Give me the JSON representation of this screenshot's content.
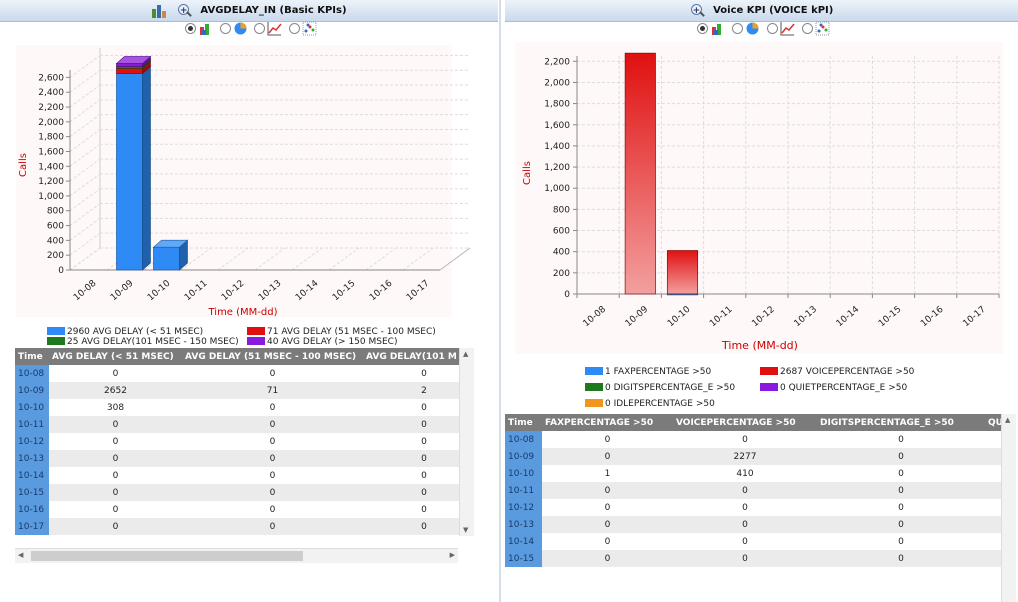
{
  "left": {
    "title": "AVGDELAY_IN (Basic KPIs)",
    "xlabel": "Time (MM-dd)",
    "ylabel": "Calls",
    "legend": [
      {
        "label": "2960 AVG DELAY (< 51 MSEC)",
        "color": "#2e8bf5"
      },
      {
        "label": "71 AVG DELAY (51 MSEC - 100 MSEC)",
        "color": "#e01010"
      },
      {
        "label": "25 AVG DELAY(101 MSEC - 150 MSEC)",
        "color": "#1f7a1f"
      },
      {
        "label": "40 AVG DELAY (> 150 MSEC)",
        "color": "#8a1adb"
      }
    ],
    "table": {
      "headers": [
        "Time",
        "AVG DELAY (< 51 MSEC)",
        "AVG DELAY (51 MSEC - 100 MSEC)",
        "AVG DELAY(101 M"
      ],
      "rows": [
        [
          "10-08",
          "0",
          "0",
          "0"
        ],
        [
          "10-09",
          "2652",
          "71",
          "2"
        ],
        [
          "10-10",
          "308",
          "0",
          "0"
        ],
        [
          "10-11",
          "0",
          "0",
          "0"
        ],
        [
          "10-12",
          "0",
          "0",
          "0"
        ],
        [
          "10-13",
          "0",
          "0",
          "0"
        ],
        [
          "10-14",
          "0",
          "0",
          "0"
        ],
        [
          "10-15",
          "0",
          "0",
          "0"
        ],
        [
          "10-16",
          "0",
          "0",
          "0"
        ],
        [
          "10-17",
          "0",
          "0",
          "0"
        ]
      ]
    }
  },
  "right": {
    "title": "Voice KPI (VOICE kPI)",
    "xlabel": "Time (MM-dd)",
    "ylabel": "Calls",
    "legend": [
      {
        "label": "1 FAXPERCENTAGE >50",
        "color": "#2e8bf5"
      },
      {
        "label": "2687 VOICEPERCENTAGE >50",
        "color": "#e01010"
      },
      {
        "label": "0 DIGITSPERCENTAGE_E >50",
        "color": "#1f7a1f"
      },
      {
        "label": "0 QUIETPERCENTAGE_E >50",
        "color": "#8a1adb"
      },
      {
        "label": "0 IDLEPERCENTAGE >50",
        "color": "#f0961e"
      }
    ],
    "table": {
      "headers": [
        "Time",
        "FAXPERCENTAGE >50",
        "VOICEPERCENTAGE >50",
        "DIGITSPERCENTAGE_E >50",
        "QU"
      ],
      "rows": [
        [
          "10-08",
          "0",
          "0",
          "0"
        ],
        [
          "10-09",
          "0",
          "2277",
          "0"
        ],
        [
          "10-10",
          "1",
          "410",
          "0"
        ],
        [
          "10-11",
          "0",
          "0",
          "0"
        ],
        [
          "10-12",
          "0",
          "0",
          "0"
        ],
        [
          "10-13",
          "0",
          "0",
          "0"
        ],
        [
          "10-14",
          "0",
          "0",
          "0"
        ],
        [
          "10-15",
          "0",
          "0",
          "0"
        ]
      ]
    }
  },
  "chart_data": [
    {
      "type": "bar",
      "stacked": true,
      "three_d": true,
      "title": "AVGDELAY_IN (Basic KPIs)",
      "xlabel": "Time (MM-dd)",
      "ylabel": "Calls",
      "ylim": [
        0,
        2700
      ],
      "yticks": [
        0,
        200,
        400,
        600,
        800,
        1000,
        1200,
        1400,
        1600,
        1800,
        2000,
        2200,
        2400,
        2600
      ],
      "ytick_labels": [
        "0",
        "200",
        "400",
        "600",
        "800",
        "1,000",
        "1,200",
        "1,400",
        "1,600",
        "1,800",
        "2,000",
        "2,200",
        "2,400",
        "2,600"
      ],
      "categories": [
        "10-08",
        "10-09",
        "10-10",
        "10-11",
        "10-12",
        "10-13",
        "10-14",
        "10-15",
        "10-16",
        "10-17"
      ],
      "series": [
        {
          "name": "AVG DELAY (< 51 MSEC)",
          "color": "#2e8bf5",
          "values": [
            0,
            2652,
            308,
            0,
            0,
            0,
            0,
            0,
            0,
            0
          ]
        },
        {
          "name": "AVG DELAY (51 MSEC - 100 MSEC)",
          "color": "#e01010",
          "values": [
            0,
            71,
            0,
            0,
            0,
            0,
            0,
            0,
            0,
            0
          ]
        },
        {
          "name": "AVG DELAY(101 MSEC - 150 MSEC)",
          "color": "#1f7a1f",
          "values": [
            0,
            25,
            0,
            0,
            0,
            0,
            0,
            0,
            0,
            0
          ]
        },
        {
          "name": "AVG DELAY (> 150 MSEC)",
          "color": "#8a1adb",
          "values": [
            0,
            40,
            0,
            0,
            0,
            0,
            0,
            0,
            0,
            0
          ]
        }
      ],
      "grid": true
    },
    {
      "type": "bar",
      "stacked": true,
      "title": "Voice KPI (VOICE kPI)",
      "xlabel": "Time (MM-dd)",
      "ylabel": "Calls",
      "ylim": [
        0,
        2250
      ],
      "yticks": [
        0,
        200,
        400,
        600,
        800,
        1000,
        1200,
        1400,
        1600,
        1800,
        2000,
        2200
      ],
      "ytick_labels": [
        "0",
        "200",
        "400",
        "600",
        "800",
        "1,000",
        "1,200",
        "1,400",
        "1,600",
        "1,800",
        "2,000",
        "2,200"
      ],
      "categories": [
        "10-08",
        "10-09",
        "10-10",
        "10-11",
        "10-12",
        "10-13",
        "10-14",
        "10-15",
        "10-16",
        "10-17"
      ],
      "series": [
        {
          "name": "FAXPERCENTAGE >50",
          "color": "#2e8bf5",
          "values": [
            0,
            0,
            1,
            0,
            0,
            0,
            0,
            0,
            0,
            0
          ]
        },
        {
          "name": "VOICEPERCENTAGE >50",
          "color": "#e01010",
          "values": [
            0,
            2277,
            410,
            0,
            0,
            0,
            0,
            0,
            0,
            0
          ]
        },
        {
          "name": "DIGITSPERCENTAGE_E >50",
          "color": "#1f7a1f",
          "values": [
            0,
            0,
            0,
            0,
            0,
            0,
            0,
            0,
            0,
            0
          ]
        },
        {
          "name": "QUIETPERCENTAGE_E >50",
          "color": "#8a1adb",
          "values": [
            0,
            0,
            0,
            0,
            0,
            0,
            0,
            0,
            0,
            0
          ]
        },
        {
          "name": "IDLEPERCENTAGE >50",
          "color": "#f0961e",
          "values": [
            0,
            0,
            0,
            0,
            0,
            0,
            0,
            0,
            0,
            0
          ]
        }
      ],
      "grid": true
    }
  ]
}
